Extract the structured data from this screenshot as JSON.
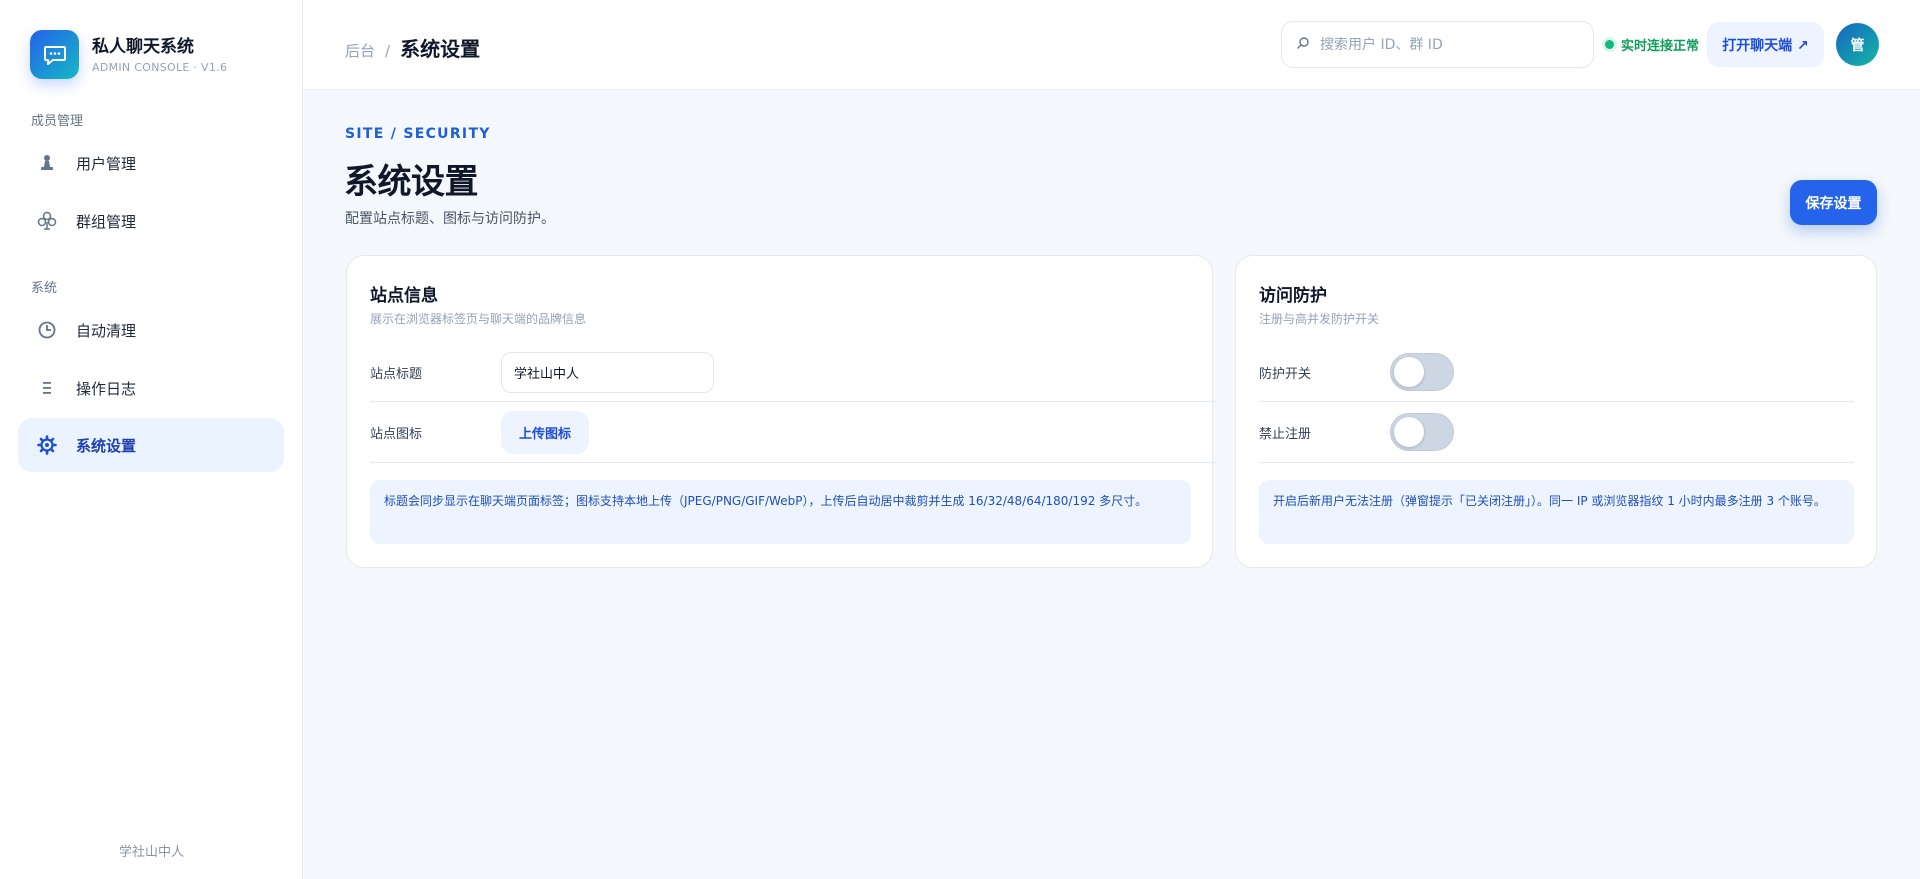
{
  "brand": {
    "name": "私人聊天系统",
    "subtitle": "ADMIN CONSOLE · V1.6",
    "logo_icon": "chat-bubble-icon",
    "accent": "#2563eb"
  },
  "sidebar": {
    "sections": [
      {
        "label": "成员管理"
      },
      {
        "label": "系统"
      }
    ],
    "items": [
      {
        "label": "用户管理",
        "icon": "user-icon"
      },
      {
        "label": "群组管理",
        "icon": "group-icon"
      },
      {
        "label": "自动清理",
        "icon": "clock-icon"
      },
      {
        "label": "操作日志",
        "icon": "list-icon"
      },
      {
        "label": "系统设置",
        "icon": "gear-icon",
        "active": true
      }
    ],
    "footer": "学社山中人"
  },
  "header": {
    "breadcrumb_root": "后台",
    "breadcrumb_sep": "/",
    "breadcrumb_current": "系统设置",
    "search_placeholder": "搜索用户 ID、群 ID",
    "status_text": "实时连接正常",
    "status_color": "#10b981",
    "open_chat_label": "打开聊天端 ↗",
    "avatar_text": "管"
  },
  "main": {
    "eyebrow": "SITE / SECURITY",
    "title": "系统设置",
    "description": "配置站点标题、图标与访问防护。",
    "save_label": "保存设置"
  },
  "site_card": {
    "title": "站点信息",
    "subtitle": "展示在浏览器标签页与聊天端的品牌信息",
    "title_label": "站点标题",
    "title_value": "学社山中人",
    "icon_label": "站点图标",
    "upload_label": "上传图标",
    "notice": "标题会同步显示在聊天端页面标签；图标支持本地上传（JPEG/PNG/GIF/WebP），上传后自动居中裁剪并生成 16/32/48/64/180/192 多尺寸。"
  },
  "security_card": {
    "title": "访问防护",
    "subtitle": "注册与高并发防护开关",
    "protection_label": "防护开关",
    "protection_on": false,
    "disable_register_label": "禁止注册",
    "disable_register_on": false,
    "notice": "开启后新用户无法注册（弹窗提示「已关闭注册」）。同一 IP 或浏览器指纹 1 小时内最多注册 3 个账号。"
  }
}
